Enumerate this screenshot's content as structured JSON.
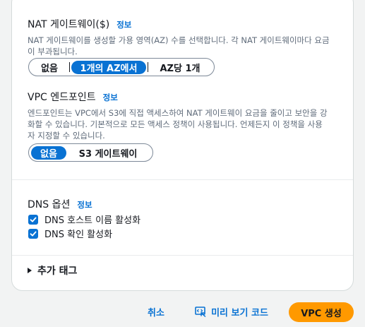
{
  "nat_gateway": {
    "label": "NAT 게이트웨이($)",
    "info": "정보",
    "desc_line1": "NAT 게이트웨이를 생성할 가용 영역(AZ) 수를 선택합니다. 각 NAT 게이트웨이마다 요금",
    "desc_line2": "이 부과됩니다.",
    "options": [
      "없음",
      "1개의 AZ에서",
      "AZ당 1개"
    ],
    "selected": "1개의 AZ에서"
  },
  "vpc_endpoint": {
    "label": "VPC 엔드포인트",
    "info": "정보",
    "desc_line1": "엔드포인트는 VPC에서 S3에 직접 액세스하여 NAT 게이트웨이 요금을 줄이고 보안을 강",
    "desc_line2": "화할 수 있습니다. 기본적으로 모든 액세스 정책이 사용됩니다. 언제든지 이 정책을 사용",
    "desc_line3": "자 지정할 수 있습니다.",
    "options": [
      "없음",
      "S3 게이트웨이"
    ],
    "selected": "없음"
  },
  "dns_options": {
    "label": "DNS 옵션",
    "info": "정보",
    "hostnames": {
      "label": "DNS 호스트 이름 활성화",
      "checked": true
    },
    "resolution": {
      "label": "DNS 확인 활성화",
      "checked": true
    }
  },
  "tags": {
    "label": "추가 태그"
  },
  "footer": {
    "cancel": "취소",
    "preview": "미리 보기 코드",
    "create": "VPC 생성"
  },
  "colors": {
    "accent": "#0972d3",
    "primary_button": "#ff9900",
    "background": "#f2f3f3"
  }
}
